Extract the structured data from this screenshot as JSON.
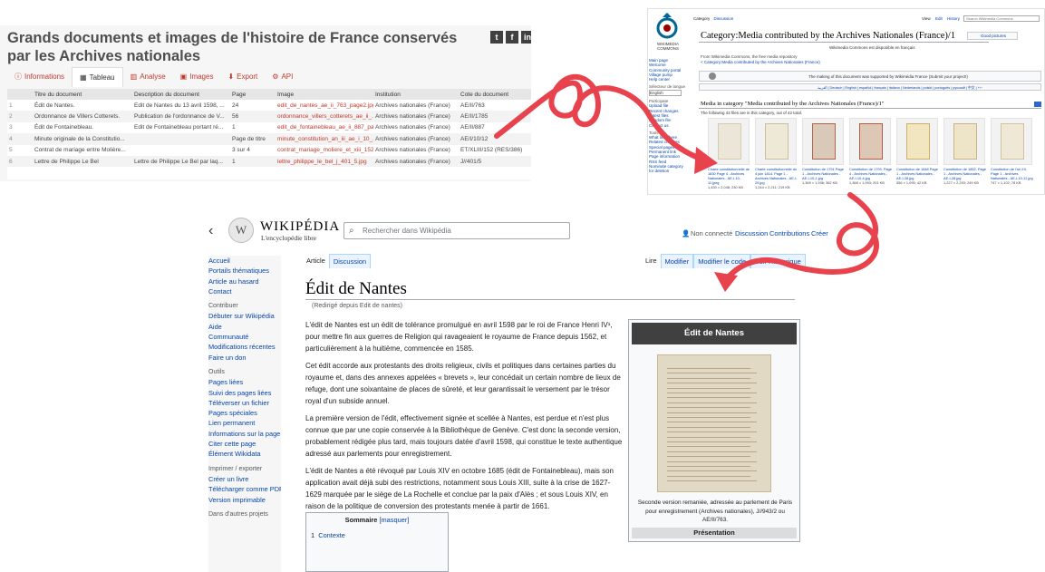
{
  "dataset": {
    "title": "Grands documents et images de l'histoire de France conservés par les Archives nationales",
    "social": [
      "t",
      "f",
      "in"
    ],
    "tabs": [
      {
        "label": "Informations",
        "icon": "info-icon",
        "glyph": "ⓘ"
      },
      {
        "label": "Tableau",
        "icon": "table-icon",
        "glyph": "▦"
      },
      {
        "label": "Analyse",
        "icon": "chart-icon",
        "glyph": "▥"
      },
      {
        "label": "Images",
        "icon": "image-icon",
        "glyph": "▣"
      },
      {
        "label": "Export",
        "icon": "download-icon",
        "glyph": "⬇"
      },
      {
        "label": "API",
        "icon": "gears-icon",
        "glyph": "⚙"
      }
    ],
    "columns": [
      "",
      "Titre du document",
      "Description du document",
      "Page",
      "Image",
      "Institution",
      "Cote du document"
    ],
    "rows": [
      [
        "1",
        "Édit de Nantes.",
        "Edit de Nantes du 13 avril 1598, ...",
        "24",
        "edit_de_nantes_ae_ii_763_page2.jpg",
        "Archives nationales (France)",
        "AE/II/763"
      ],
      [
        "2",
        "Ordonnance de Villers Cotterets.",
        "Publication de l'ordonnance de V...",
        "56",
        "ordonnance_villers_cotterets_ae_ii_...",
        "Archives nationales (France)",
        "AE/II/1785"
      ],
      [
        "3",
        "Édit de Fontainebleau.",
        "Edit de Fontainebleau portant ré...",
        "1",
        "edit_de_fontainebleau_ae_ii_887_pa...",
        "Archives nationales (France)",
        "AE/II/887"
      ],
      [
        "4",
        "Minute originale de la Constitutio...",
        "",
        "Page de titre",
        "minute_constitution_an_iii_ae_i_10_...",
        "Archives nationales (France)",
        "AE/I/10/12"
      ],
      [
        "5",
        "Contrat de mariage entre Molière...",
        "",
        "3 sur 4",
        "contrat_mariage_moliere_et_xiii_152...",
        "Archives nationales (France)",
        "ET/XLIII/152 (RES/386)"
      ],
      [
        "6",
        "Lettre de Philippe Le Bel",
        "Lettre de Philippe Le Bel par laq...",
        "1",
        "lettre_philippe_le_bel_j_401_5.jpg",
        "Archives nationales (France)",
        "J//401/5"
      ]
    ]
  },
  "commons": {
    "logo_text": "WIKIMEDIA COMMONS",
    "tabs_left": [
      "Category",
      "Discussion"
    ],
    "tabs_right": [
      "View",
      "Edit",
      "History"
    ],
    "search_placeholder": "Search Wikimedia Commons",
    "title": "Category:Media contributed by the Archives Nationales (France)/1",
    "top_right": "Good pictures",
    "subtitle": "Wikimedia Commons est disponible en français",
    "from_line": "From Wikimedia Commons, the free media repository",
    "breadcrumb": "< Category:Media contributed by the Archives Nationales (France)",
    "support_line": "The making of this document was supported by Wikimédia France (Submit your project!)",
    "languages": "العربية | Deutsch | English | español | français | italiano | Nederlands | polski | português | русский | 中文 | +/−",
    "side_links": [
      "Main page",
      "Welcome",
      "Community portal",
      "Village pump",
      "Help center"
    ],
    "side_lang_label": "Sélecteur de langue",
    "side_lang_value": "English",
    "side_head": "Participate",
    "side_links2": [
      "Upload file",
      "Recent changes",
      "Latest files",
      "Random file",
      "Contact us"
    ],
    "side_head2": "Tools",
    "side_links3": [
      "What links here",
      "Related changes",
      "Special pages",
      "Permanent link",
      "Page information",
      "RSS feed",
      "Nominate category for deletion"
    ],
    "section": "Media in category \"Media contributed by the Archives Nationales (France)/1\"",
    "count": "The following 42 files are in this category, out of 42 total.",
    "thumbs": [
      {
        "caption": "Charte constitutionnelle de 1830 Page 4 - Archives Nationales - AE-I-10-11.jpeg",
        "size": "1,430 × 2,048; 230 KB"
      },
      {
        "caption": "Charte constitutionnelle du 4 juin 1814. Page 1 - Archives Nationales - AE-I-29.jpg",
        "size": "1,244 × 2,211; 219 KB"
      },
      {
        "caption": "Constitution de 1791 Page 1 - Archives Nationales - AE-I-10-1.jpg",
        "size": "1,369 × 1,936; 362 KB"
      },
      {
        "caption": "Constitution de 1793. Page 4 - Archives Nationales - AE-I-10-4.jpg",
        "size": "1,368 × 1,993; 201 KB"
      },
      {
        "caption": "Constitution de 1848 Page 1 - Archives Nationales - AE-I-28.jpg",
        "size": "556 × 1,095; 42 KB"
      },
      {
        "caption": "Constitution de 1852. Page 1 - Archives Nationales - AE-I-28.jpg",
        "size": "1,227 × 2,293; 249 KB"
      },
      {
        "caption": "Constitution de l'an XII. Page 1 - Archives Nationales - AE-I-10-12.jpg",
        "size": "747 × 1,102; 78 KB"
      }
    ]
  },
  "wiki": {
    "name": "WIKIPÉDIA",
    "tagline": "L'encyclopédie libre",
    "search_placeholder": "Rechercher dans Wikipédia",
    "user": {
      "not_logged": "Non connecté",
      "discussion": "Discussion",
      "contributions": "Contributions",
      "create": "Créer"
    },
    "sidebar": {
      "main": [
        "Accueil",
        "Portails thématiques",
        "Article au hasard",
        "Contact"
      ],
      "head1": "Contribuer",
      "contrib": [
        "Débuter sur Wikipédia",
        "Aide",
        "Communauté",
        "Modifications récentes",
        "Faire un don"
      ],
      "head2": "Outils",
      "tools": [
        "Pages liées",
        "Suivi des pages liées",
        "Téléverser un fichier",
        "Pages spéciales",
        "Lien permanent",
        "Informations sur la page",
        "Citer cette page",
        "Élément Wikidata"
      ],
      "head3": "Imprimer / exporter",
      "print": [
        "Créer un livre",
        "Télécharger comme PDF",
        "Version imprimable"
      ],
      "head4": "Dans d'autres projets"
    },
    "tabs_left": [
      "Article",
      "Discussion"
    ],
    "tabs_right": [
      "Lire",
      "Modifier",
      "Modifier le code",
      "Voir l'historique"
    ],
    "title": "Édit de Nantes",
    "redirect": "(Redirigé depuis Edit de nantes)",
    "p1": "L'édit de Nantes est un édit de tolérance promulgué en avril 1598 par le roi de France Henri IV¹, pour mettre fin aux guerres de Religion qui ravageaient le royaume de France depuis 1562, et particulièrement à la huitième, commencée en 1585.",
    "p2": "Cet édit accorde aux protestants des droits religieux, civils et politiques dans certaines parties du royaume et, dans des annexes appelées « brevets », leur concédait un certain nombre de lieux de refuge, dont une soixantaine de places de sûreté, et leur garantissait le versement par le trésor royal d'un subside annuel.",
    "p3": "La première version de l'édit, effectivement signée et scellée à Nantes, est perdue et n'est plus connue que par une copie conservée à la Bibliothèque de Genève. C'est donc la seconde version, probablement rédigée plus tard, mais toujours datée d'avril 1598, qui constitue le texte authentique adressé aux parlements pour enregistrement.",
    "p4": "L'édit de Nantes a été révoqué par Louis XIV en octobre 1685 (édit de Fontainebleau), mais son application avait déjà subi des restrictions, notamment sous Louis XIII, suite à la crise de 1627-1629 marquée par le siège de La Rochelle et conclue par la paix d'Alès ; et sous Louis XIV, en raison de la politique de conversion des protestants menée à partir de 1661.",
    "toc_title": "Sommaire",
    "toc_toggle": "[masquer]",
    "toc_item_num": "1",
    "toc_item": "Contexte",
    "infobox_title": "Édit de Nantes",
    "infobox_caption": "Seconde version remaniée, adressée au parlement de Paris pour enregistrement (Archives nationales), J//943/2 ou AE/II/763.",
    "infobox_section": "Présentation"
  }
}
